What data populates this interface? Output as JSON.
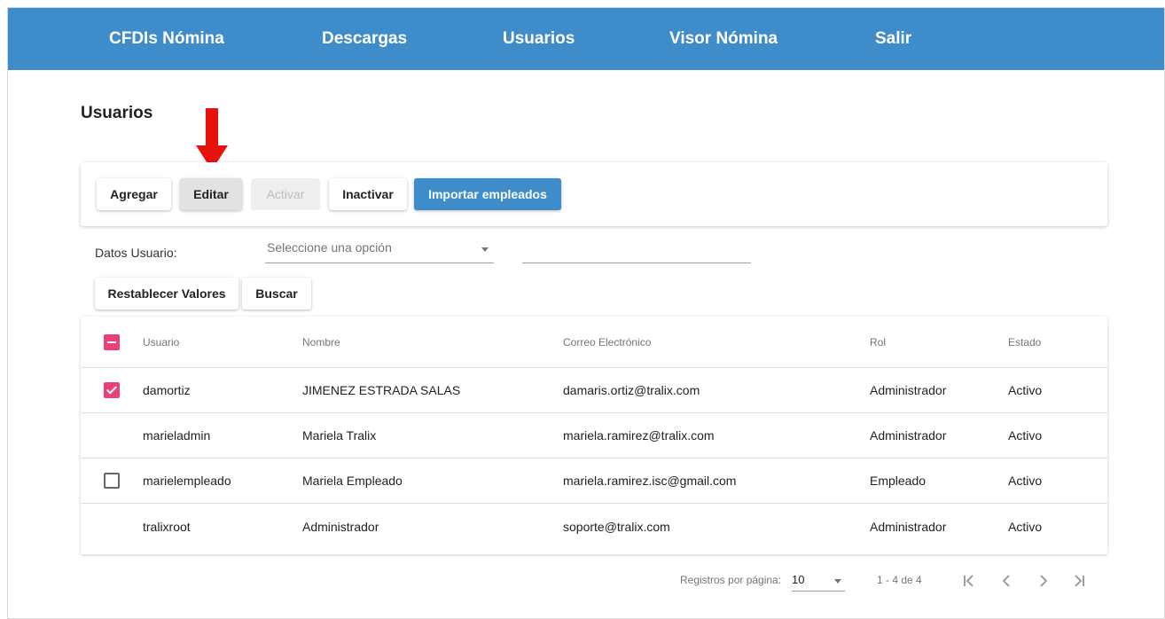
{
  "nav": {
    "items": [
      {
        "label": "CFDIs Nómina"
      },
      {
        "label": "Descargas"
      },
      {
        "label": "Usuarios"
      },
      {
        "label": "Visor Nómina"
      },
      {
        "label": "Salir"
      }
    ]
  },
  "page": {
    "title": "Usuarios"
  },
  "toolbar": {
    "add_label": "Agregar",
    "edit_label": "Editar",
    "activate_label": "Activar",
    "deactivate_label": "Inactivar",
    "import_label": "Importar empleados"
  },
  "filter": {
    "label": "Datos Usuario:",
    "select_placeholder": "Seleccione una opción",
    "value": "",
    "reset_label": "Restablecer Valores",
    "search_label": "Buscar"
  },
  "table": {
    "columns": {
      "user": "Usuario",
      "name": "Nombre",
      "email": "Correo Electrónico",
      "role": "Rol",
      "status": "Estado"
    },
    "rows": [
      {
        "user": "damortiz",
        "name": "JIMENEZ ESTRADA SALAS",
        "email": "damaris.ortiz@tralix.com",
        "role": "Administrador",
        "status": "Activo",
        "checkbox": "checked"
      },
      {
        "user": "marieladmin",
        "name": "Mariela Tralix",
        "email": "mariela.ramirez@tralix.com",
        "role": "Administrador",
        "status": "Activo",
        "checkbox": "none"
      },
      {
        "user": "marielempleado",
        "name": "Mariela Empleado",
        "email": "mariela.ramirez.isc@gmail.com",
        "role": "Empleado",
        "status": "Activo",
        "checkbox": "empty"
      },
      {
        "user": "tralixroot",
        "name": "Administrador",
        "email": "soporte@tralix.com",
        "role": "Administrador",
        "status": "Activo",
        "checkbox": "none"
      }
    ]
  },
  "paginator": {
    "per_page_label": "Registros por página:",
    "per_page_value": "10",
    "range_label": "1 - 4 de 4"
  },
  "colors": {
    "brand": "#3f8ccb",
    "accent": "#e9407a",
    "annotation_arrow": "#e8120c"
  }
}
